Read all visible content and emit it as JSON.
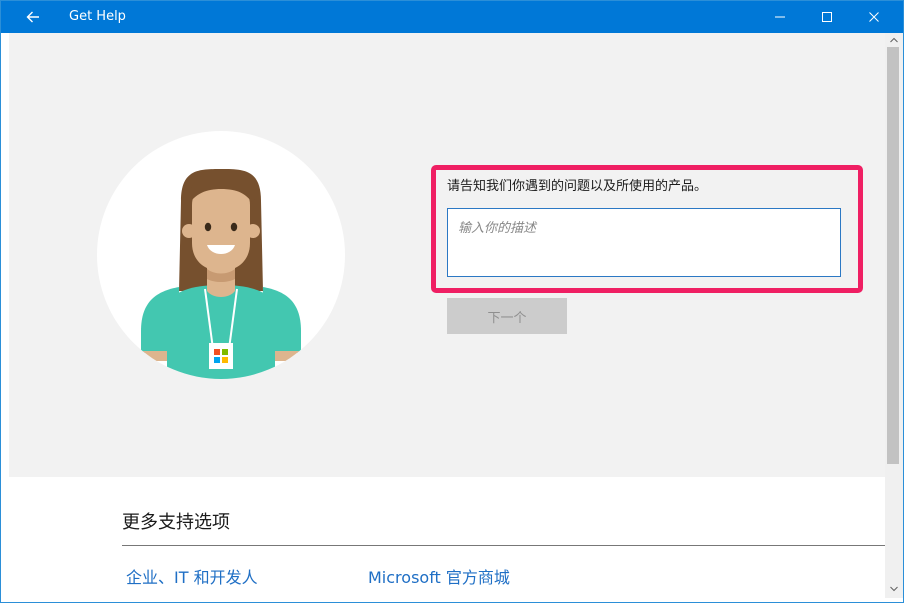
{
  "window": {
    "title": "Get Help",
    "controls": {
      "back": "arrow-left-icon",
      "minimize": "minimize-icon",
      "maximize": "maximize-icon",
      "close": "close-icon"
    }
  },
  "help": {
    "prompt": "请告知我们你遇到的问题以及所使用的产品。",
    "input_value": "",
    "input_placeholder": "输入你的描述",
    "next_label": "下一个"
  },
  "support": {
    "title": "更多支持选项",
    "links": [
      {
        "label": "企业、IT 和开发人"
      },
      {
        "label": "Microsoft 官方商城"
      }
    ]
  },
  "colors": {
    "accent": "#0078d7",
    "highlight": "#ef1f63",
    "link": "#1f6fc5",
    "shirt": "#43c7b0",
    "hair": "#76502e",
    "skin": "#ddb58e"
  }
}
